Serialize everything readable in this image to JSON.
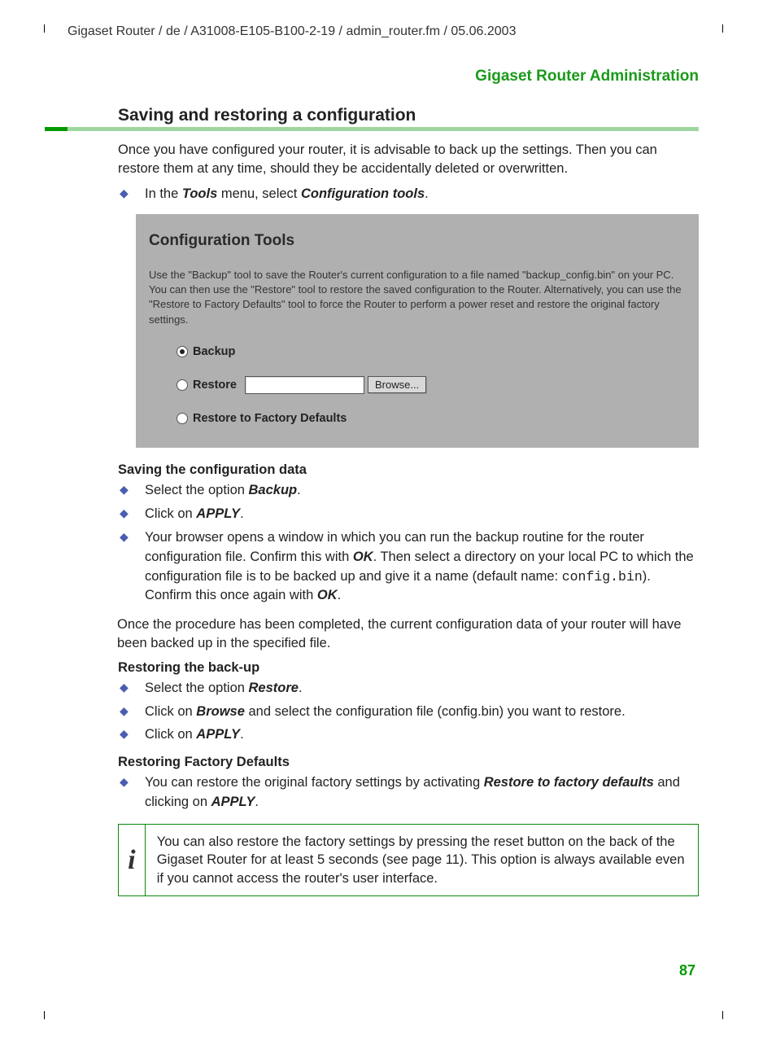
{
  "header_path": "Gigaset Router / de / A31008-E105-B100-2-19 / admin_router.fm / 05.06.2003",
  "section_label": "Gigaset Router Administration",
  "page_title": "Saving and restoring a configuration",
  "intro": "Once you have configured your router, it is advisable to back up the settings. Then you can restore them at any time, should they be accidentally deleted or overwritten.",
  "intro_bullet_pre": "In the ",
  "intro_bullet_b1": "Tools",
  "intro_bullet_mid": " menu, select ",
  "intro_bullet_b2": "Configuration tools",
  "intro_bullet_post": ".",
  "screenshot": {
    "title": "Configuration Tools",
    "desc": "Use the \"Backup\" tool to save the Router's current configuration to a file named \"backup_config.bin\" on your PC. You can then use the \"Restore\" tool to restore the saved configuration to the Router. Alternatively, you can use the \"Restore to Factory Defaults\" tool to force the Router to perform a power reset and restore the original factory settings.",
    "opt_backup": "Backup",
    "opt_restore": "Restore",
    "browse_label": "Browse...",
    "opt_factory": "Restore to Factory Defaults"
  },
  "sub1": "Saving the configuration data",
  "sub1_li1_pre": "Select the option ",
  "sub1_li1_b": "Backup",
  "sub1_li1_post": ".",
  "sub1_li2_pre": "Click on ",
  "sub1_li2_b": "APPLY",
  "sub1_li2_post": ".",
  "sub1_li3_a": "Your browser opens a window in which you can run the backup routine for the router configuration file. Confirm this with ",
  "sub1_li3_b1": "OK",
  "sub1_li3_b": ". Then select a directory on your local PC to which the configuration file is to be backed up and give it a name (default name: ",
  "sub1_li3_mono": "config.bin",
  "sub1_li3_c": "). Confirm this once again with ",
  "sub1_li3_b2": "OK",
  "sub1_li3_d": ".",
  "after_sub1": "Once the procedure has been completed, the current configuration data of your router will have been backed up in the specified file.",
  "sub2": "Restoring the back-up",
  "sub2_li1_pre": "Select the option ",
  "sub2_li1_b": "Restore",
  "sub2_li1_post": ".",
  "sub2_li2_pre": "Click on ",
  "sub2_li2_b": "Browse",
  "sub2_li2_post": " and select the configuration file (config.bin) you want to restore.",
  "sub2_li3_pre": "Click on ",
  "sub2_li3_b": "APPLY",
  "sub2_li3_post": ".",
  "sub3": "Restoring Factory Defaults",
  "sub3_li1_pre": "You can restore the original factory settings by activating ",
  "sub3_li1_b": "Restore to factory defaults",
  "sub3_li1_mid": " and clicking on ",
  "sub3_li1_b2": "APPLY",
  "sub3_li1_post": ".",
  "info_icon": "i",
  "info_text": "You can also restore the factory settings by pressing the reset button on the back of the Gigaset Router for at least 5 seconds (see page 11). This option is always available even if you cannot access the router's user interface.",
  "page_number": "87"
}
